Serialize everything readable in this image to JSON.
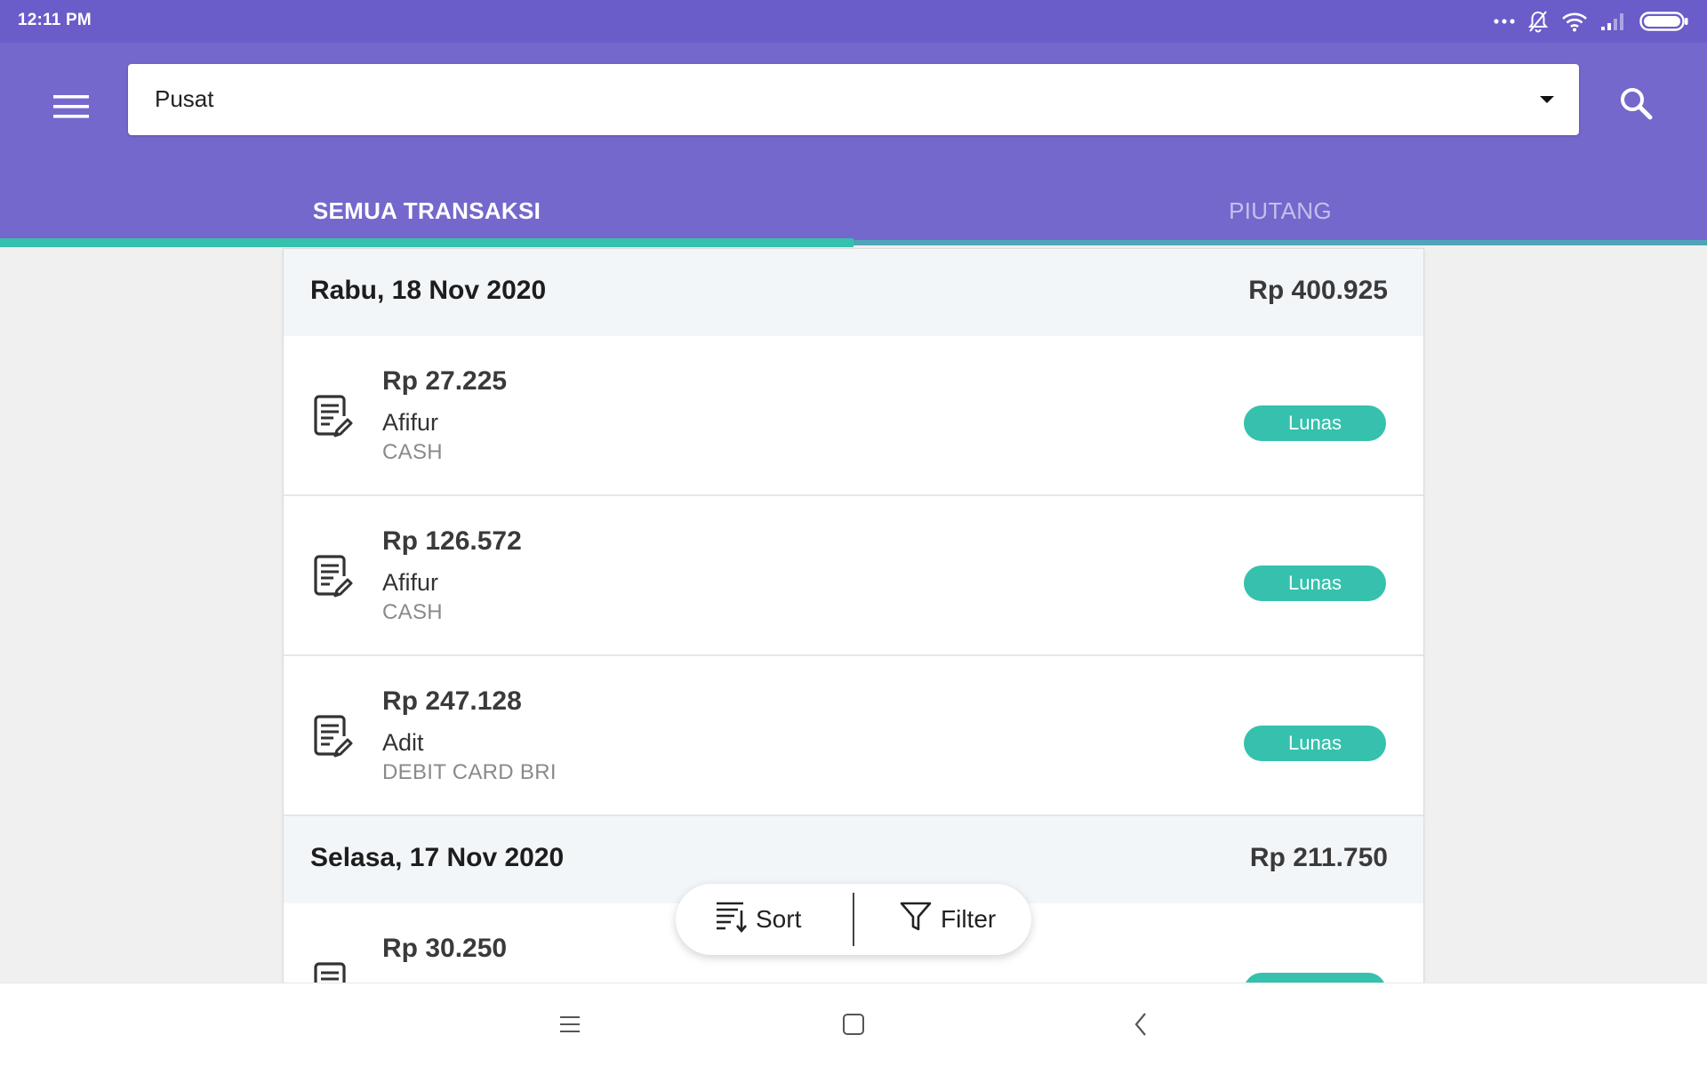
{
  "status_bar": {
    "time": "12:11 PM",
    "icons": [
      "more-dots-icon",
      "notifications-off-icon",
      "wifi-icon",
      "signal-icon",
      "battery-icon"
    ]
  },
  "app_bar": {
    "menu_icon": "hamburger-menu-icon",
    "location": {
      "value": "Pusat",
      "icon": "dropdown-caret-icon"
    },
    "search_icon": "search-icon",
    "tabs": [
      {
        "label": "SEMUA TRANSAKSI",
        "selected": true
      },
      {
        "label": "PIUTANG",
        "selected": false
      }
    ]
  },
  "transactions": {
    "groups": [
      {
        "day": "Rabu, 18 Nov 2020",
        "total": "Rp 400.925",
        "items": [
          {
            "amount": "Rp 27.225",
            "name": "Afifur",
            "method": "CASH",
            "status": "Lunas"
          },
          {
            "amount": "Rp 126.572",
            "name": "Afifur",
            "method": "CASH",
            "status": "Lunas"
          },
          {
            "amount": "Rp 247.128",
            "name": "Adit",
            "method": "DEBIT CARD BRI",
            "status": "Lunas"
          }
        ]
      },
      {
        "day": "Selasa, 17 Nov 2020",
        "total": "Rp 211.750",
        "items": [
          {
            "amount": "Rp 30.250"
          }
        ]
      }
    ]
  },
  "actions": {
    "sort_label": "Sort",
    "filter_label": "Filter"
  },
  "nav_bar": {
    "icons": [
      "recents-icon",
      "home-icon",
      "back-icon"
    ]
  },
  "colors": {
    "status_bar": "#6a5cc9",
    "app_bar": "#7468cc",
    "accent_teal": "#35c1ad",
    "day_header_bg": "#f3f6f9"
  }
}
